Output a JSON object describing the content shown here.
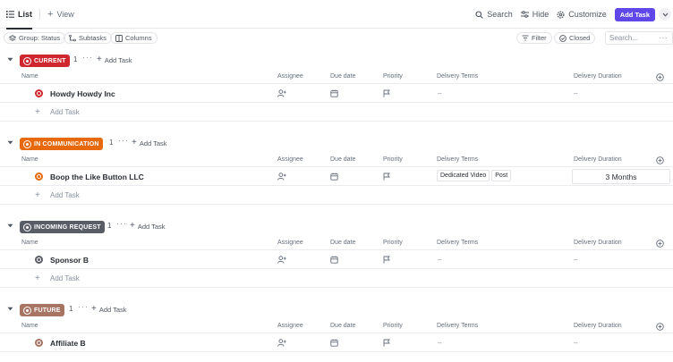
{
  "toolbar": {
    "list_tab": "List",
    "view_tab": "View",
    "search_label": "Search",
    "hide_label": "Hide",
    "customize_label": "Customize",
    "add_task_label": "Add Task"
  },
  "filters": {
    "group_label": "Group: Status",
    "subtasks_label": "Subtasks",
    "columns_label": "Columns",
    "filter_label": "Filter",
    "closed_label": "Closed",
    "search_placeholder": "Search..."
  },
  "columns": [
    "Name",
    "Assignee",
    "Due date",
    "Priority",
    "Delivery Terms",
    "Delivery Duration"
  ],
  "add_task_label": "Add Task",
  "groups": [
    {
      "label": "CURRENT",
      "color": "#d0262d",
      "count": "1",
      "task": {
        "name": "Howdy Howdy Inc",
        "delivery_terms": "–",
        "delivery_duration": "–"
      }
    },
    {
      "label": "IN COMMUNICATION",
      "color": "#e8680c",
      "count": "1",
      "task": {
        "name": "Boop the Like Button LLC",
        "delivery_terms": [
          "Dedicated Video",
          "Post"
        ],
        "delivery_duration": "3 Months"
      }
    },
    {
      "label": "INCOMING REQUEST",
      "color": "#595d66",
      "count": "1",
      "task": {
        "name": "Sponsor B",
        "delivery_terms": "–",
        "delivery_duration": "–"
      }
    },
    {
      "label": "FUTURE",
      "color": "#a87464",
      "count": "1",
      "task": {
        "name": "Affiliate B",
        "delivery_terms": "–",
        "delivery_duration": "–"
      }
    }
  ]
}
